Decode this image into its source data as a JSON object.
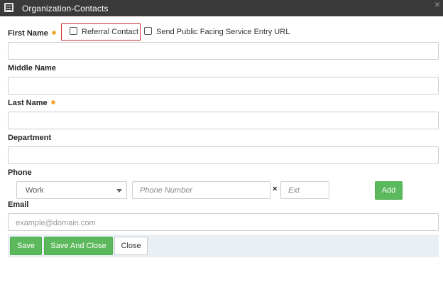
{
  "window": {
    "title": "Organization-Contacts",
    "close_glyph": "×"
  },
  "form": {
    "first_name_label": "First Name",
    "referral_contact_label": "Referral Contact",
    "send_public_url_label": "Send Public Facing Service Entry URL",
    "middle_name_label": "Middle Name",
    "last_name_label": "Last Name",
    "department_label": "Department",
    "phone_label": "Phone",
    "phone_type_value": "Work",
    "phone_number_placeholder": "Phone Number",
    "ext_separator": "×",
    "ext_placeholder": "Ext",
    "add_label": "Add",
    "email_label": "Email",
    "email_placeholder": "example@domain.com"
  },
  "footer": {
    "save_label": "Save",
    "save_close_label": "Save And Close",
    "close_label": "Close"
  },
  "colors": {
    "accent_green": "#5cb85c",
    "required_dot": "#f0a020",
    "highlight_red": "#c9302c"
  }
}
